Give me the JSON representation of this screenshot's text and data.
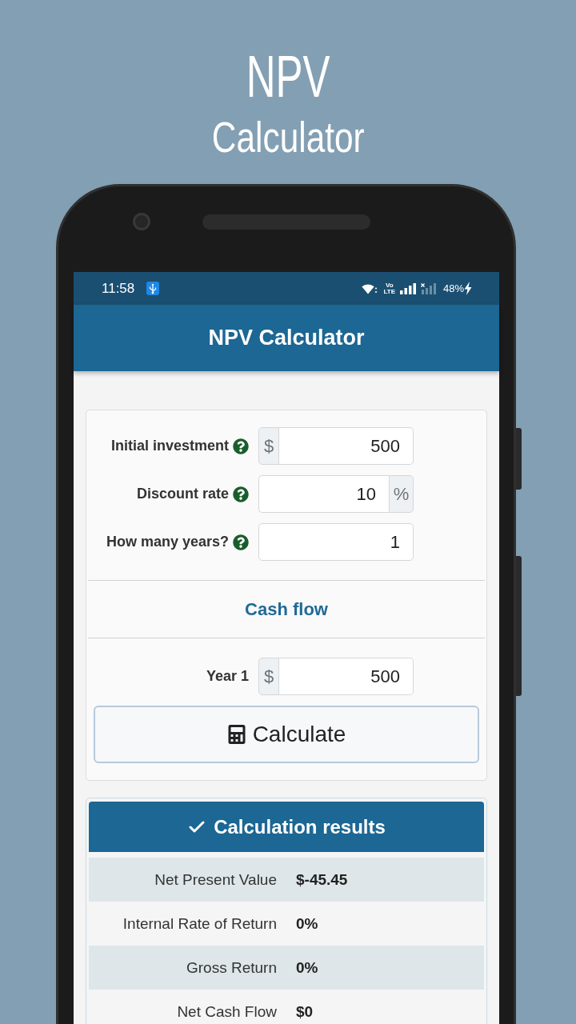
{
  "promo": {
    "title": "NPV",
    "subtitle": "Calculator"
  },
  "status_bar": {
    "time": "11:58",
    "network_type": "Vo LTE",
    "battery": "48%",
    "charging": true
  },
  "app_bar": {
    "title": "NPV Calculator"
  },
  "inputs": [
    {
      "label": "Initial investment",
      "help": true,
      "prefix": "$",
      "value": "500"
    },
    {
      "label": "Discount rate",
      "help": true,
      "suffix": "%",
      "value": "10"
    },
    {
      "label": "How many years?",
      "help": true,
      "value": "1"
    }
  ],
  "cash_flow": {
    "title": "Cash flow",
    "years": [
      {
        "label": "Year 1",
        "prefix": "$",
        "value": "500"
      }
    ]
  },
  "calculate_button": {
    "label": "Calculate"
  },
  "results": {
    "title": "Calculation results",
    "rows": [
      {
        "label": "Net Present Value",
        "value": "$-45.45"
      },
      {
        "label": "Internal Rate of Return",
        "value": "0%"
      },
      {
        "label": "Gross Return",
        "value": "0%"
      },
      {
        "label": "Net Cash Flow",
        "value": "$0"
      }
    ]
  }
}
